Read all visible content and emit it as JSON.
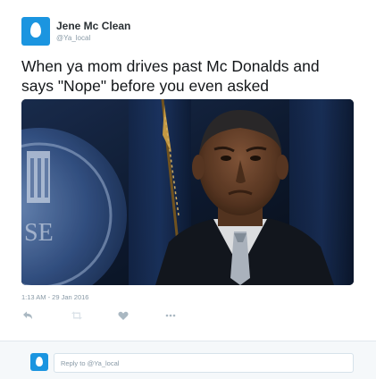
{
  "tweet": {
    "author": {
      "name": "Jene Mc Clean",
      "handle": "@Ya_local",
      "avatar_icon": "default-egg-avatar-icon"
    },
    "text": "When ya mom drives past Mc Donalds and\nsays \"Nope\" before you even asked",
    "media": {
      "kind": "photo",
      "seal_text": "SE"
    },
    "timestamp": "1:13 AM - 29 Jan 2016",
    "actions": [
      {
        "name": "reply",
        "icon": "reply-icon"
      },
      {
        "name": "retweet",
        "icon": "retweet-icon"
      },
      {
        "name": "like",
        "icon": "heart-icon"
      },
      {
        "name": "more",
        "icon": "more-icon"
      }
    ]
  },
  "reply_box": {
    "placeholder": "Reply to @Ya_local",
    "avatar_icon": "default-egg-avatar-icon"
  },
  "colors": {
    "avatar_bg": "#1b95e0",
    "muted_text": "#8899a6",
    "link_blue": "#1b95e0",
    "reply_area_bg": "#f5f8fa",
    "action_icon": "#aab8c2"
  }
}
